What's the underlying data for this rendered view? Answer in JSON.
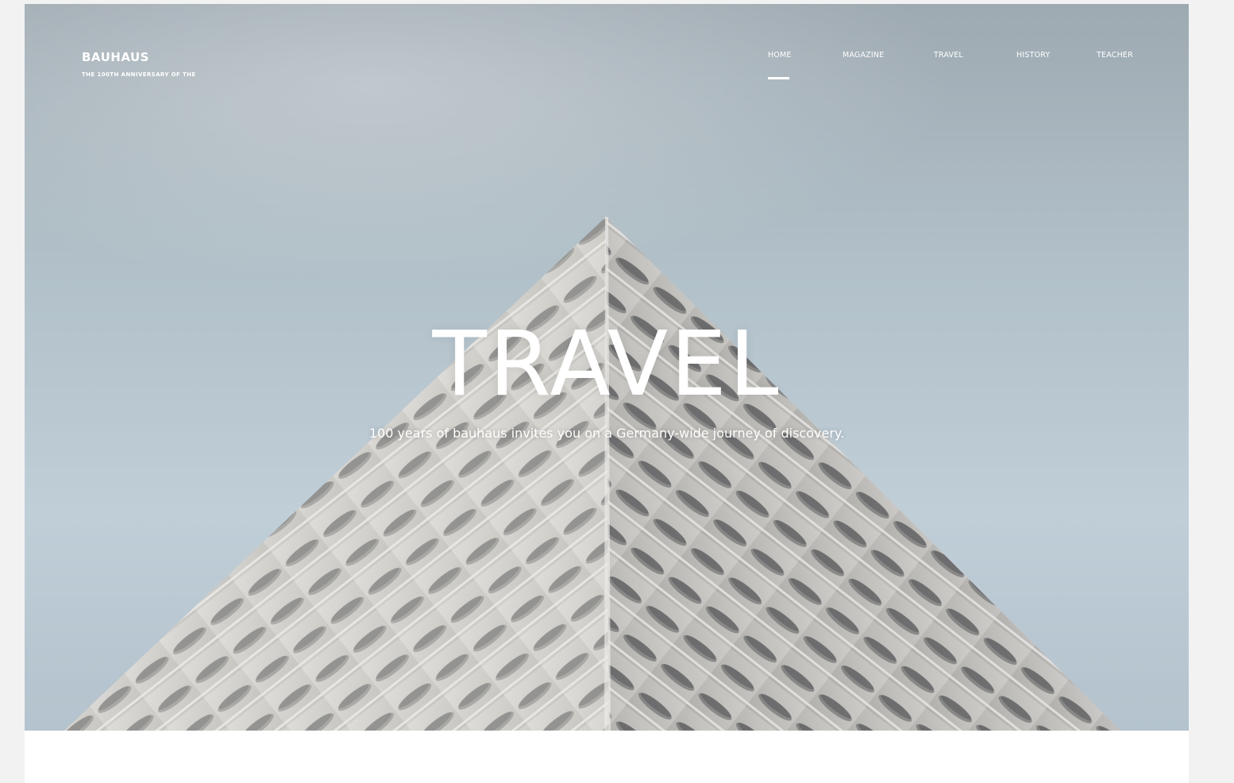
{
  "brand": {
    "title": "BAUHAUS",
    "subtitle": "THE 100TH ANNIVERSARY OF THE"
  },
  "nav": {
    "items": [
      {
        "label": "HOME",
        "active": true
      },
      {
        "label": "MAGAZINE",
        "active": false
      },
      {
        "label": "TRAVEL",
        "active": false
      },
      {
        "label": "HISTORY",
        "active": false
      },
      {
        "label": "TEACHER",
        "active": false
      }
    ]
  },
  "hero": {
    "title": "TRAVEL",
    "subtitle": "100 years of bauhaus invites you on a Germany-wide journey of discovery.",
    "image": "geometric-building-photo"
  },
  "colors": {
    "background": "#f2f2f2",
    "sky": "#c9d8e2",
    "text": "#ffffff"
  }
}
